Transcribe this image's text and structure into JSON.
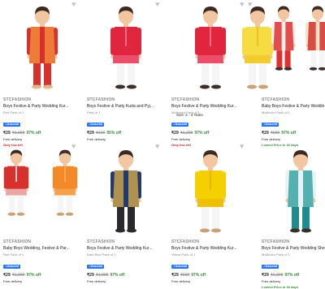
{
  "heart_icon": "♥",
  "products": [
    {
      "brand": "STCFASHION",
      "title": "Boys Festive & Party Wedding Kur...",
      "variant": "Red Pack of 1",
      "assured": "✓Assured",
      "price": "₹29",
      "mrp": "₹1,999",
      "off": "97% off",
      "free": "Free delivery",
      "note": "Only few left",
      "note_style": "red",
      "fig": {
        "top": "#d8302c",
        "trim": "#f08a3a",
        "bottom": "#d8302c",
        "skin": "#f2c6a0",
        "jacket": true,
        "shoes": "#e0b98a"
      }
    },
    {
      "brand": "STCFASHION",
      "title": "Boys Festive & Party Kurta and Pyj...",
      "variant": "Pack of 1",
      "assured": "✓Assured",
      "price": "₹29",
      "mrp": "₹699",
      "off": "95% off",
      "free": "Free delivery",
      "note": "",
      "note_style": "none",
      "fig": {
        "top": "#e0253f",
        "trim": "#f46a86",
        "bottom": "#f5f5f5",
        "skin": "#f2c6a0",
        "jacket": false,
        "shoes": "#3a2e2a"
      }
    },
    {
      "brand": "STCFASHION",
      "title": "Boys Festive & Party Wedding Kur...",
      "variant": "Multicolor Pack of 1",
      "assured": "✓Assured",
      "price": "₹29",
      "mrp": "₹1,299",
      "off": "97% off",
      "free": "Free delivery",
      "note": "Only few left",
      "note_style": "red",
      "fig": {
        "top": "#e0253f",
        "trim": "#f46a86",
        "bottom": "#f5f5f5",
        "skin": "#f2c6a0",
        "jacket": false,
        "shoes": "#3a2e2a"
      }
    },
    {
      "brand": "STCFASHION",
      "title": "Boys Festive & Party Wedding Kur...",
      "variant": "Orange Pack of 1",
      "assured": "✓Assured",
      "price": "₹29",
      "mrp": "₹699",
      "off": "95% off",
      "free": "Free delivery",
      "note": "Lowest price in the year",
      "note_style": "green",
      "fig": {
        "top": "#f5dc42",
        "trim": "#f0c020",
        "bottom": "#f5f5f5",
        "skin": "#f2c6a0",
        "jacket": false,
        "shoes": "#c9a27a"
      }
    },
    {
      "brand": "STCFASHION",
      "title": "Baby Boys Festive & Party Weddin...",
      "variant": "Multicolor Pack of 1",
      "assured": "✓Assured",
      "price": "₹29",
      "mrp": "₹999",
      "off": "97% off",
      "free": "Free delivery",
      "note": "Lowest Price in 30 days",
      "note_style": "green",
      "fig": {
        "top": "#f7f2ea",
        "trim": "#e03030",
        "bottom": "#e03030",
        "skin": "#f2c6a0",
        "jacket": true,
        "shoes": "#3a2e2a"
      }
    },
    {
      "brand": "STCFASHION",
      "title": "Baby Boys Wedding, Festive & Par...",
      "variant": "Red Pack of 1",
      "assured": "✓Assured",
      "price": "₹29",
      "mrp": "₹1,999",
      "off": "97% off",
      "free": "Free delivery",
      "note": "",
      "note_style": "none",
      "fig": {
        "top": "#d8302c",
        "trim": "#f5f5f5",
        "bottom": "#f5f5f5",
        "skin": "#f2c6a0",
        "jacket": false,
        "shoes": "#c9a27a"
      }
    },
    {
      "brand": "STCFASHION",
      "title": "Boys Festive & Party Wedding Kur...",
      "variant": "Dark Blue Pack of 1",
      "assured": "✓Assured",
      "price": "₹29",
      "mrp": "₹1,999",
      "off": "97% off",
      "free": "Free delivery",
      "note": "",
      "note_style": "none",
      "fig": {
        "top": "#233a6e",
        "trim": "#c8a24a",
        "bottom": "#2a2a2e",
        "skin": "#f2c6a0",
        "jacket": true,
        "shoes": "#2a2a2e"
      }
    },
    {
      "brand": "STCFASHION",
      "title": "Boys Festive & Party Wedding Kur...",
      "variant": "Yellow Pack of 1",
      "assured": "✓Assured",
      "price": "₹29",
      "mrp": "₹999",
      "off": "97% off",
      "free": "Free delivery",
      "note": "",
      "note_style": "none",
      "fig": {
        "top": "#f5d000",
        "trim": "#e8b800",
        "bottom": "#f5f5f5",
        "skin": "#f2c6a0",
        "jacket": false,
        "shoes": "#c9a27a"
      }
    },
    {
      "brand": "STCFASHION",
      "title": "Boys Festive & Party Wedding She...",
      "variant": "Multicolor Pack of 1",
      "assured": "✓Assured",
      "price": "₹29",
      "mrp": "₹1,999",
      "off": "97% off",
      "free": "Free delivery",
      "note": "Lowest Price in 30 days",
      "note_style": "green",
      "fig": {
        "top": "#e9f2f4",
        "trim": "#3aa6a6",
        "bottom": "#1e8c8c",
        "skin": "#f2c6a0",
        "jacket": true,
        "shoes": "#3a2e2a"
      }
    }
  ],
  "extras": {
    "size_text": "Size: 2 - 4 Years",
    "orange_kid": {
      "top": "#f28a2a",
      "trim": "#f5b060",
      "bottom": "#f5f5f5",
      "skin": "#f2c6a0",
      "jacket": false,
      "shoes": "#c9a27a"
    },
    "second_kid": {
      "top": "#f0e3c8",
      "trim": "#d8302c",
      "bottom": "#f5f5f5",
      "skin": "#f2c6a0",
      "jacket": true,
      "shoes": "#3a2e2a"
    }
  }
}
